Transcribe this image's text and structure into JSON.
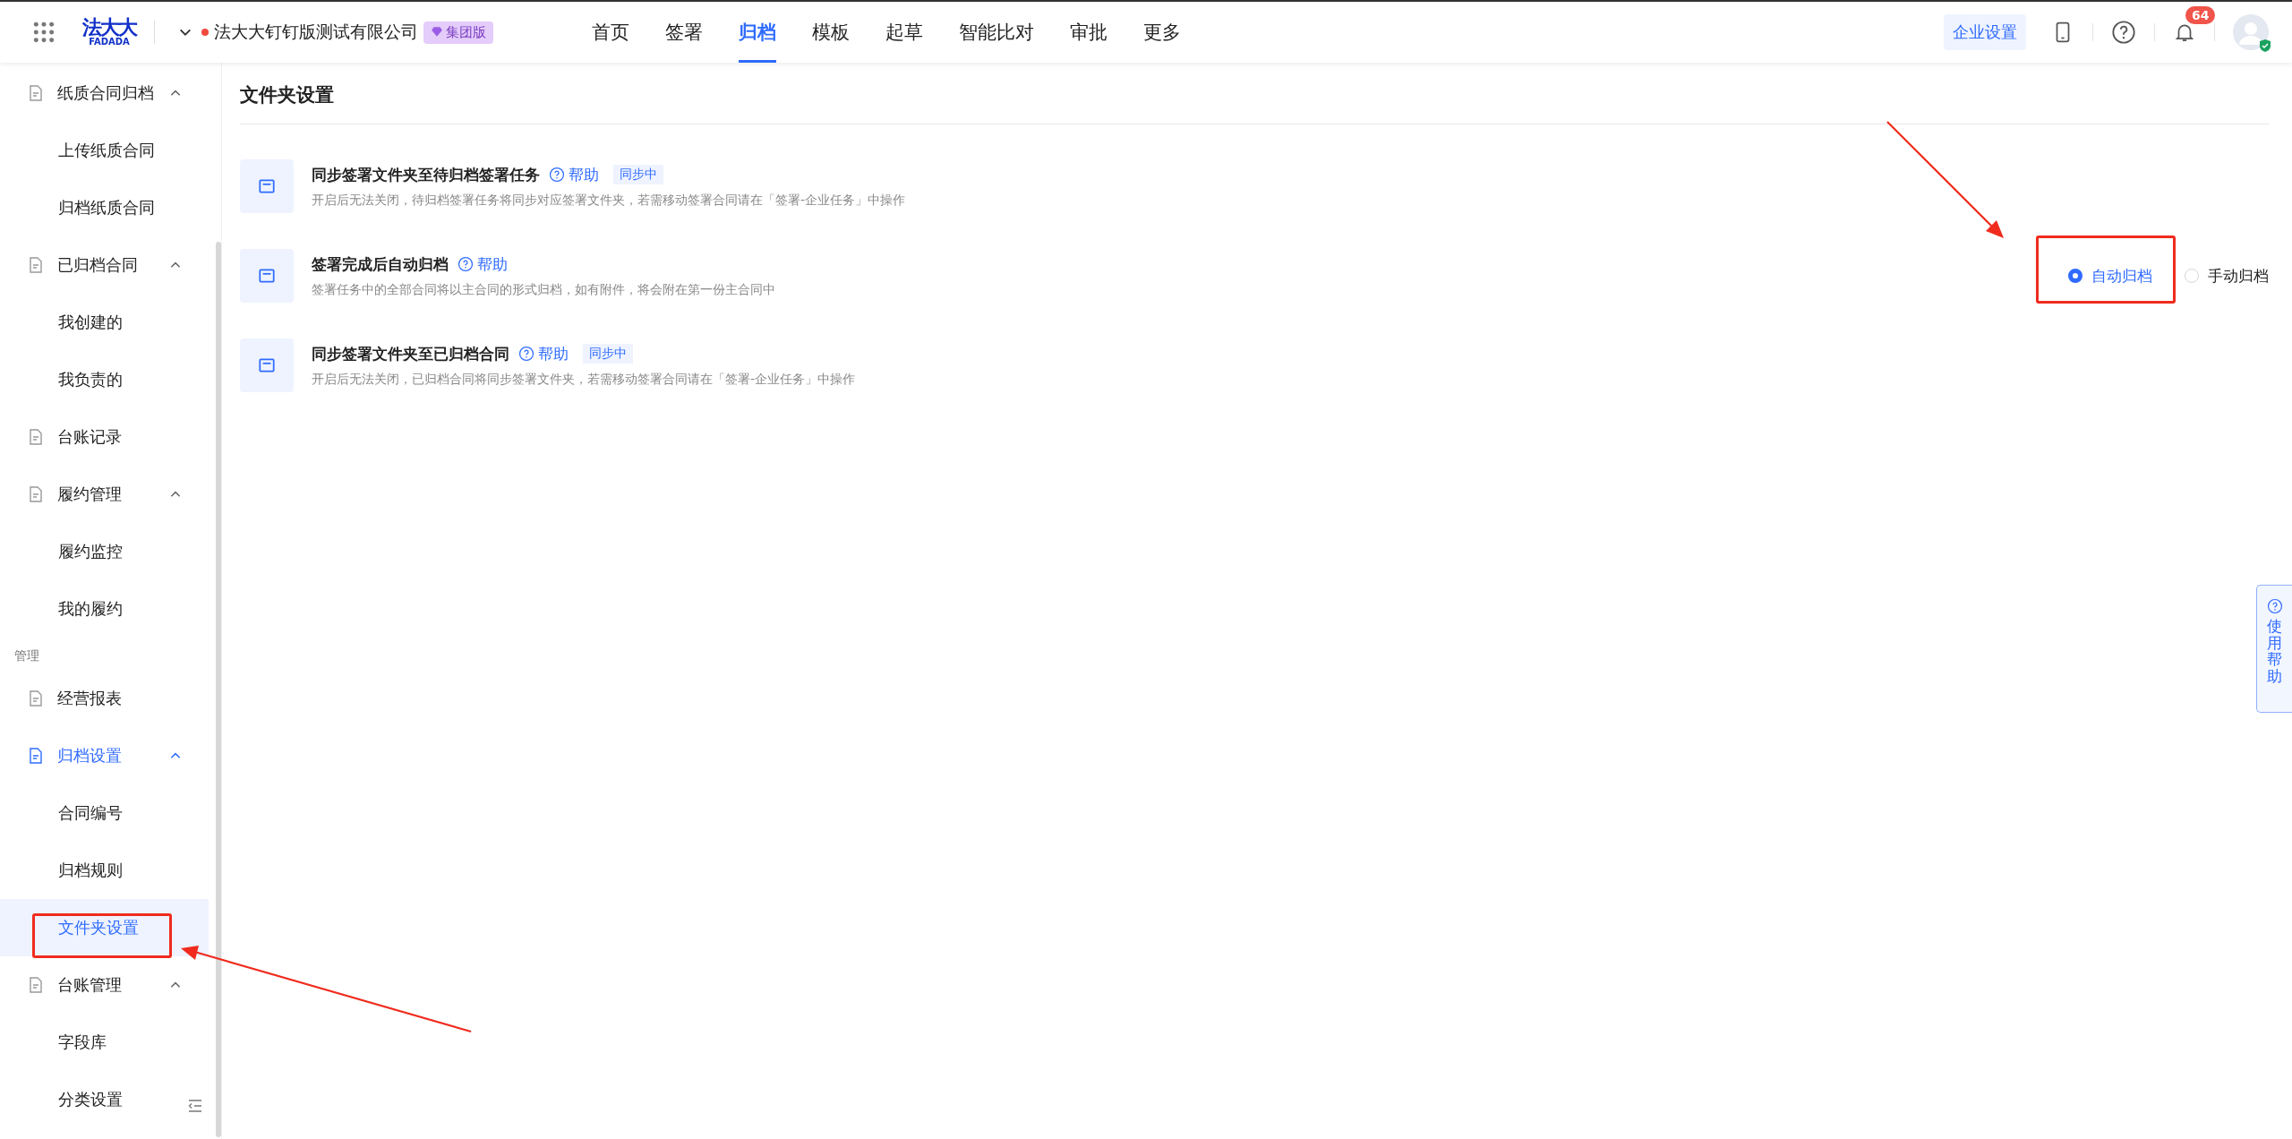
{
  "header": {
    "logo": {
      "text": "法大大",
      "subtext": "FADADA"
    },
    "company": "法大大钉钉版测试有限公司",
    "edition_badge": "集团版",
    "nav": [
      {
        "label": "首页",
        "selected": false
      },
      {
        "label": "签署",
        "selected": false
      },
      {
        "label": "归档",
        "selected": true
      },
      {
        "label": "模板",
        "selected": false
      },
      {
        "label": "起草",
        "selected": false
      },
      {
        "label": "智能比对",
        "selected": false
      },
      {
        "label": "审批",
        "selected": false
      },
      {
        "label": "更多",
        "selected": false
      }
    ],
    "settings_button": "企业设置",
    "notification_count": "64"
  },
  "sidebar": {
    "items": [
      {
        "kind": "group",
        "label": "纸质合同归档",
        "expanded": true,
        "children": [
          {
            "label": "上传纸质合同",
            "selected": false
          },
          {
            "label": "归档纸质合同",
            "selected": false
          }
        ]
      },
      {
        "kind": "group",
        "label": "已归档合同",
        "expanded": true,
        "children": [
          {
            "label": "我创建的",
            "selected": false
          },
          {
            "label": "我负责的",
            "selected": false
          }
        ]
      },
      {
        "kind": "link",
        "label": "台账记录",
        "selected": false
      },
      {
        "kind": "group",
        "label": "履约管理",
        "expanded": true,
        "children": [
          {
            "label": "履约监控",
            "selected": false
          },
          {
            "label": "我的履约",
            "selected": false
          }
        ]
      },
      {
        "kind": "section",
        "label": "管理"
      },
      {
        "kind": "link",
        "label": "经营报表",
        "selected": false
      },
      {
        "kind": "group",
        "label": "归档设置",
        "expanded": true,
        "children": [
          {
            "label": "合同编号",
            "selected": false
          },
          {
            "label": "归档规则",
            "selected": false
          },
          {
            "label": "文件夹设置",
            "selected": true
          }
        ]
      },
      {
        "kind": "group",
        "label": "台账管理",
        "expanded": true,
        "children": [
          {
            "label": "字段库",
            "selected": false
          },
          {
            "label": "分类设置",
            "selected": false
          }
        ]
      }
    ]
  },
  "content": {
    "title": "文件夹设置",
    "settings": [
      {
        "title": "同步签署文件夹至待归档签署任务",
        "help": "帮助",
        "status": "同步中",
        "description": "开启后无法关闭，待归档签署任务将同步对应签署文件夹，若需移动签署合同请在「签署-企业任务」中操作"
      },
      {
        "title": "签署完成后自动归档",
        "help": "帮助",
        "description": "签署任务中的全部合同将以主合同的形式归档，如有附件，将会附在第一份主合同中",
        "options": [
          {
            "label": "自动归档",
            "selected": true
          },
          {
            "label": "手动归档",
            "selected": false
          }
        ]
      },
      {
        "title": "同步签署文件夹至已归档合同",
        "help": "帮助",
        "status": "同步中",
        "description": "开启后无法关闭，已归档合同将同步签署文件夹，若需移动签署合同请在「签署-企业任务」中操作"
      }
    ]
  },
  "help_tab": "使用帮助"
}
